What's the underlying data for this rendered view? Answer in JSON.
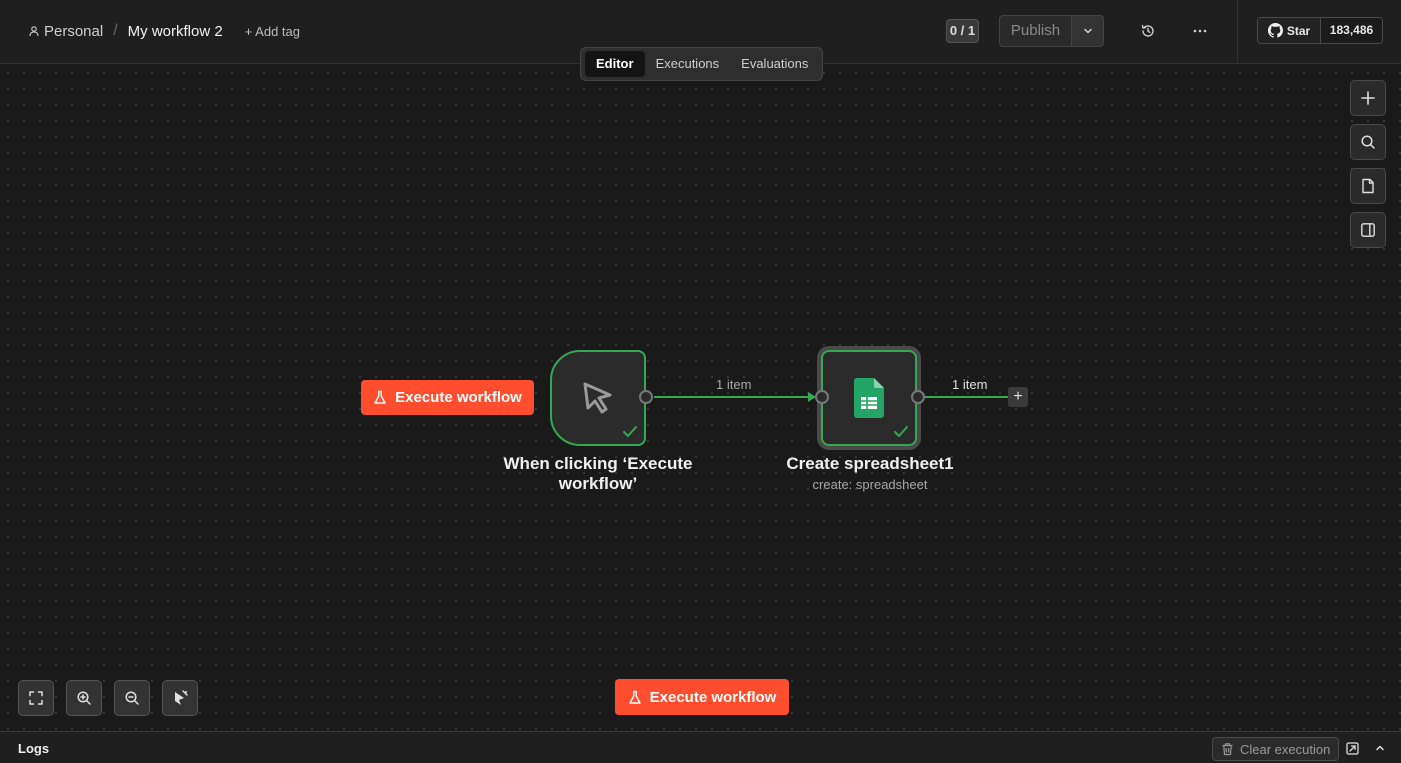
{
  "header": {
    "project": "Personal",
    "separator": "/",
    "workflow_name": "My workflow 2",
    "add_tag": "+ Add tag",
    "counter": "0 / 1",
    "publish_label": "Publish",
    "github_star_label": "Star",
    "github_star_count": "183,486"
  },
  "tabs": [
    {
      "label": "Editor",
      "active": true
    },
    {
      "label": "Executions",
      "active": false
    },
    {
      "label": "Evaluations",
      "active": false
    }
  ],
  "canvas": {
    "execute_workflow_label": "Execute workflow",
    "bottom_execute_label": "Execute workflow",
    "trigger_node": {
      "title_line1": "When clicking ‘Execute",
      "title_line2": "workflow’",
      "status": "success",
      "icon": "pointer-icon"
    },
    "sheet_node": {
      "title": "Create spreadsheet1",
      "subtitle": "create: spreadsheet",
      "status": "success",
      "icon": "google-sheets-icon"
    },
    "edge1_label": "1 item",
    "edge2_label": "1 item",
    "add_node_symbol": "+"
  },
  "logs": {
    "title": "Logs",
    "clear_execution": "Clear execution"
  },
  "colors": {
    "accent": "#ff4d2e",
    "success": "#34a853",
    "background": "#1a1a1a"
  }
}
